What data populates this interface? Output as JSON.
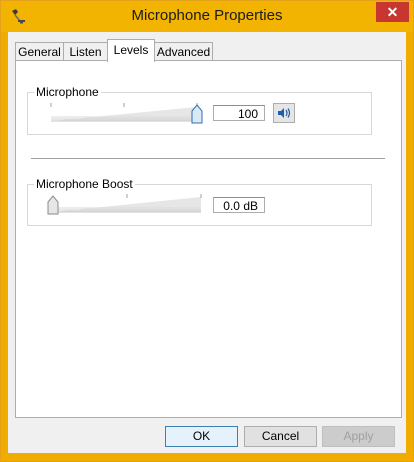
{
  "window": {
    "title": "Microphone Properties",
    "close_glyph": "✕",
    "accent_color": "#f2b400"
  },
  "tabs": [
    {
      "label": "General",
      "active": false
    },
    {
      "label": "Listen",
      "active": false
    },
    {
      "label": "Levels",
      "active": true
    },
    {
      "label": "Advanced",
      "active": false
    }
  ],
  "levels": {
    "microphone": {
      "label": "Microphone",
      "value_text": "100",
      "level_fraction": 1.0,
      "mute_icon": "speaker-icon"
    },
    "boost": {
      "label": "Microphone Boost",
      "value_text": "0.0 dB",
      "level_fraction": 0.0
    }
  },
  "buttons": {
    "ok": "OK",
    "cancel": "Cancel",
    "apply": "Apply"
  }
}
